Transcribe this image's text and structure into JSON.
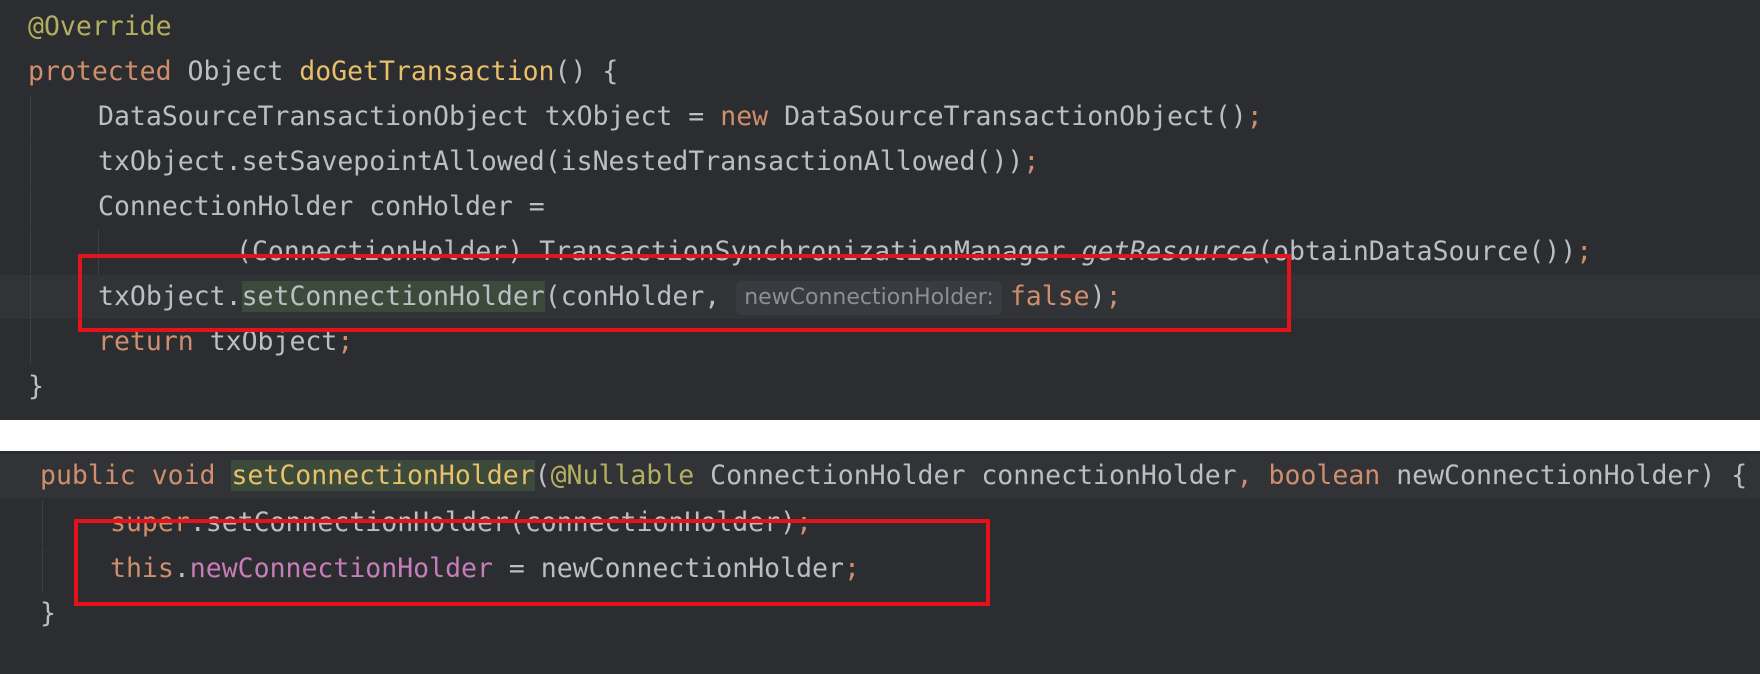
{
  "top_snippet": {
    "l1": {
      "annotation": "@Override"
    },
    "l2": {
      "kw": "protected",
      "type": " Object ",
      "method": "doGetTransaction",
      "rest": "() {"
    },
    "l3": {
      "a": "DataSourceTransactionObject txObject = ",
      "kw": "new",
      "b": " DataSourceTransactionObject()",
      "semi": ";"
    },
    "l4": {
      "a": "txObject.setSavepointAllowed(isNestedTransactionAllowed())",
      "semi": ";"
    },
    "l5": {
      "a": "ConnectionHolder conHolder ="
    },
    "l6": {
      "a": "(ConnectionHolder) TransactionSynchronizationManager.",
      "method": "getResource",
      "b": "(obtainDataSource())",
      "semi": ";"
    },
    "l7": {
      "a": "txObject.",
      "method": "setConnectionHolder",
      "b": "(conHolder, ",
      "hint": "newConnectionHolder:",
      "value": "false",
      "c": ")",
      "semi": ";"
    },
    "l8": {
      "kw": "return",
      "a": " txObject",
      "semi": ";"
    },
    "l9": {
      "a": "}"
    }
  },
  "bottom_snippet": {
    "l1": {
      "kw1": "public",
      "kw2": " void ",
      "method": "setConnectionHolder",
      "paren": "(",
      "annotation": "@Nullable",
      "a": " ConnectionHolder connectionHolder",
      "comma": ", ",
      "kw3": "boolean",
      "b": " newConnectionHolder) {"
    },
    "l2": {
      "kw": "super",
      "a": ".setConnectionHolder(connectionHolder)",
      "semi": ";"
    },
    "l3": {
      "kw": "this",
      "dot": ".",
      "field": "newConnectionHolder",
      "a": " = newConnectionHolder",
      "semi": ";"
    },
    "l4": {
      "a": "}"
    }
  },
  "colors": {
    "editor_background": "#2b2d30",
    "keyword": "#cf8e6d",
    "annotation": "#b3ae60",
    "field": "#c77dbb",
    "plain_text": "#bcbec4",
    "highlight_box": "#e3121b"
  }
}
